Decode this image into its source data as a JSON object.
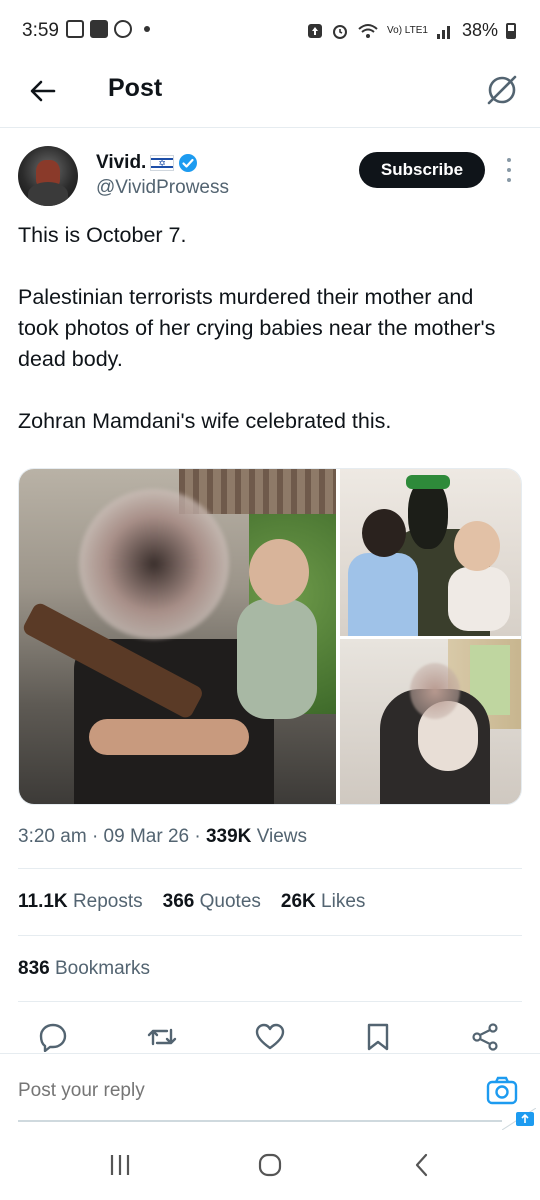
{
  "status_bar": {
    "time": "3:59",
    "network_label": "Vo) LTE1",
    "battery": "38%"
  },
  "header": {
    "title": "Post",
    "back_icon": "arrow-left-icon",
    "grok_icon": "grok-slash-circle-icon"
  },
  "author": {
    "name": "Vivid.",
    "handle": "@VividProwess",
    "flag_icon": "israel-flag-icon",
    "verified_color": "#1d9bf0",
    "subscribe_label": "Subscribe"
  },
  "tweet": {
    "paragraphs": [
      "This is October 7.",
      "Palestinian terrorists murdered their mother and took photos of her crying babies near the mother's dead body.",
      "Zohran Mamdani's wife celebrated this."
    ]
  },
  "meta": {
    "time": "3:20 am",
    "date": "09 Mar 26",
    "views_count": "339K",
    "views_label": "Views"
  },
  "stats": {
    "reposts_count": "11.1K",
    "reposts_label": "Reposts",
    "quotes_count": "366",
    "quotes_label": "Quotes",
    "likes_count": "26K",
    "likes_label": "Likes",
    "bookmarks_count": "836",
    "bookmarks_label": "Bookmarks"
  },
  "actions": [
    "reply-icon",
    "repost-icon",
    "like-icon",
    "bookmark-icon",
    "share-icon"
  ],
  "reply": {
    "placeholder": "Post your reply"
  },
  "colors": {
    "text": "#0f1419",
    "secondary": "#536471",
    "accent": "#1d9bf0",
    "subscribe_bg": "#0f1419"
  }
}
